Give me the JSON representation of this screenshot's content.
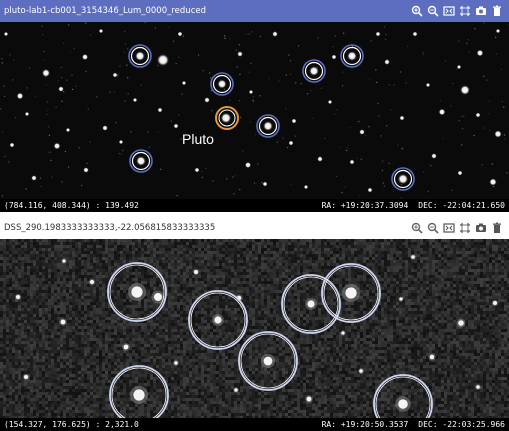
{
  "top_panel": {
    "title": "pluto-lab1-cb001_3154346_Lum_0000_reduced",
    "pluto_label": "Pluto",
    "status": {
      "pixel_readout": "(784.116, 408.344) : 139.492",
      "ra": "RA: +19:20:37.3094",
      "dec": "DEC: -22:04:21.650"
    },
    "marker_colors": {
      "star": "#ffffff",
      "ring": "#5d6ec1",
      "pluto": "#e8983c"
    }
  },
  "bottom_panel": {
    "title": "DSS_290.1983333333333,-22.056815833333335",
    "status": {
      "pixel_readout": "(154.327, 176.625) : 2,321.0",
      "ra": "RA: +19:20:50.3537",
      "dec": "DEC: -22:03:25.966"
    },
    "marker_colors": {
      "ring": "#cfd6f5"
    }
  },
  "toolbar_icons": [
    "zoom-in-icon",
    "zoom-out-icon",
    "zoom-fit-icon",
    "crop-icon",
    "camera-icon",
    "trash-icon"
  ],
  "colors": {
    "titlebar_top": "#5d6ec1",
    "status_bg": "#000000"
  }
}
